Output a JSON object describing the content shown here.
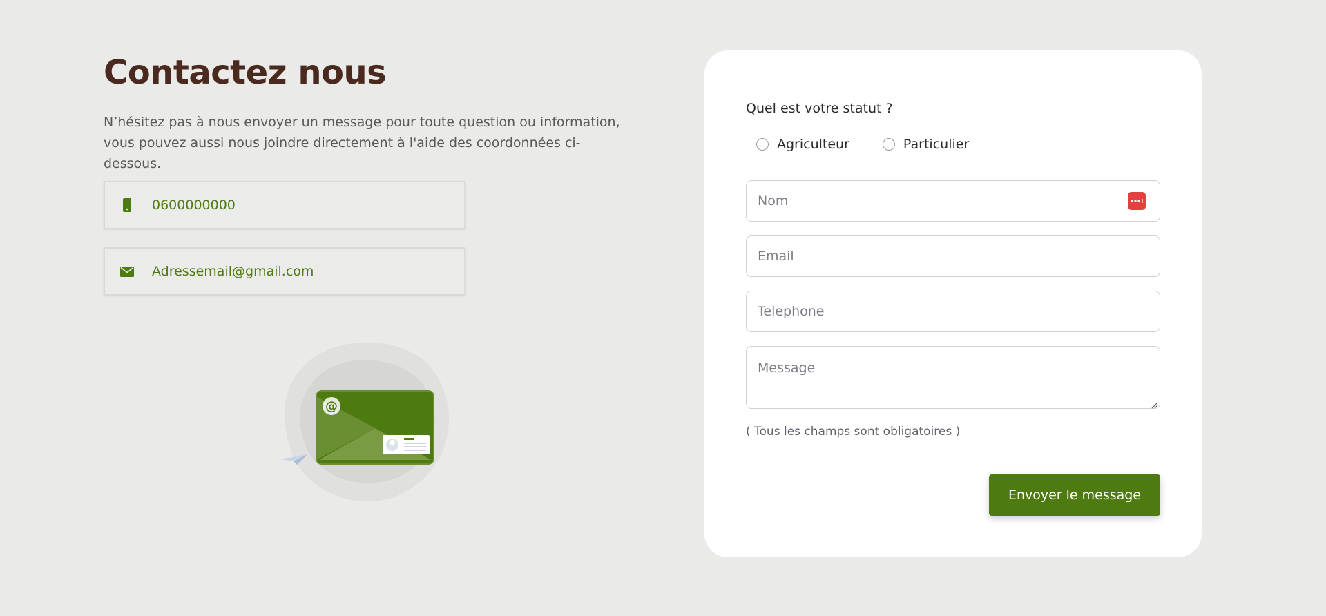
{
  "header": {
    "title": "Contactez nous",
    "intro": "N’hésitez pas à nous envoyer un message pour toute question ou information, vous pouvez aussi nous joindre directement à l'aide des coordonnées ci-dessous."
  },
  "contacts": {
    "phone": {
      "icon": "phone-icon",
      "value": "0600000000"
    },
    "email": {
      "icon": "envelope-icon",
      "value": "Adressemail@gmail.com"
    }
  },
  "form": {
    "status_question": "Quel est votre statut ?",
    "radio_options": [
      "Agriculteur",
      "Particulier"
    ],
    "fields": {
      "nom_placeholder": "Nom",
      "email_placeholder": "Email",
      "telephone_placeholder": "Telephone",
      "message_placeholder": "Message"
    },
    "required_note": "( Tous les champs sont obligatoires )",
    "submit_label": "Envoyer le message"
  },
  "colors": {
    "accent": "#4e7a12",
    "title": "#4a2a1e",
    "background": "#eaebe8",
    "card": "#ffffff"
  }
}
